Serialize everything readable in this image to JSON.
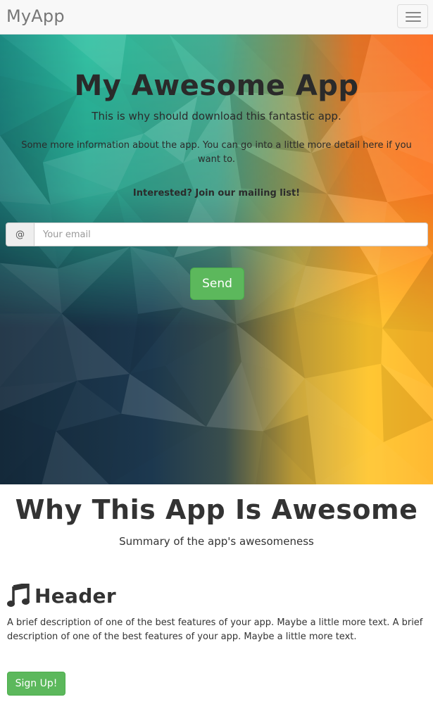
{
  "navbar": {
    "brand": "MyApp",
    "toggle_icon": "hamburger-menu-icon"
  },
  "hero": {
    "title": "My Awesome App",
    "subtitle": "This is why should download this fantastic app.",
    "info": "Some more information about the app. You can go into a little more detail here if you want to.",
    "cta": "Interested? Join our mailing list!",
    "email_addon": "@",
    "email_placeholder": "Your email",
    "send_label": "Send"
  },
  "why": {
    "title": "Why This App Is Awesome",
    "summary": "Summary of the app's awesomeness"
  },
  "feature": {
    "icon": "music-note-icon",
    "header": "Header",
    "description": "A brief description of one of the best features of your app. Maybe a little more text. A brief description of one of the best features of your app. Maybe a little more text.",
    "signup_label": "Sign Up!"
  },
  "colors": {
    "success_button": "#5cb85c",
    "navbar_bg": "#f8f8f8",
    "hero_teal": "#2cc0a0",
    "hero_orange": "#fd6e20",
    "hero_yellow": "#ffc62e",
    "hero_navy": "#1c3448"
  }
}
